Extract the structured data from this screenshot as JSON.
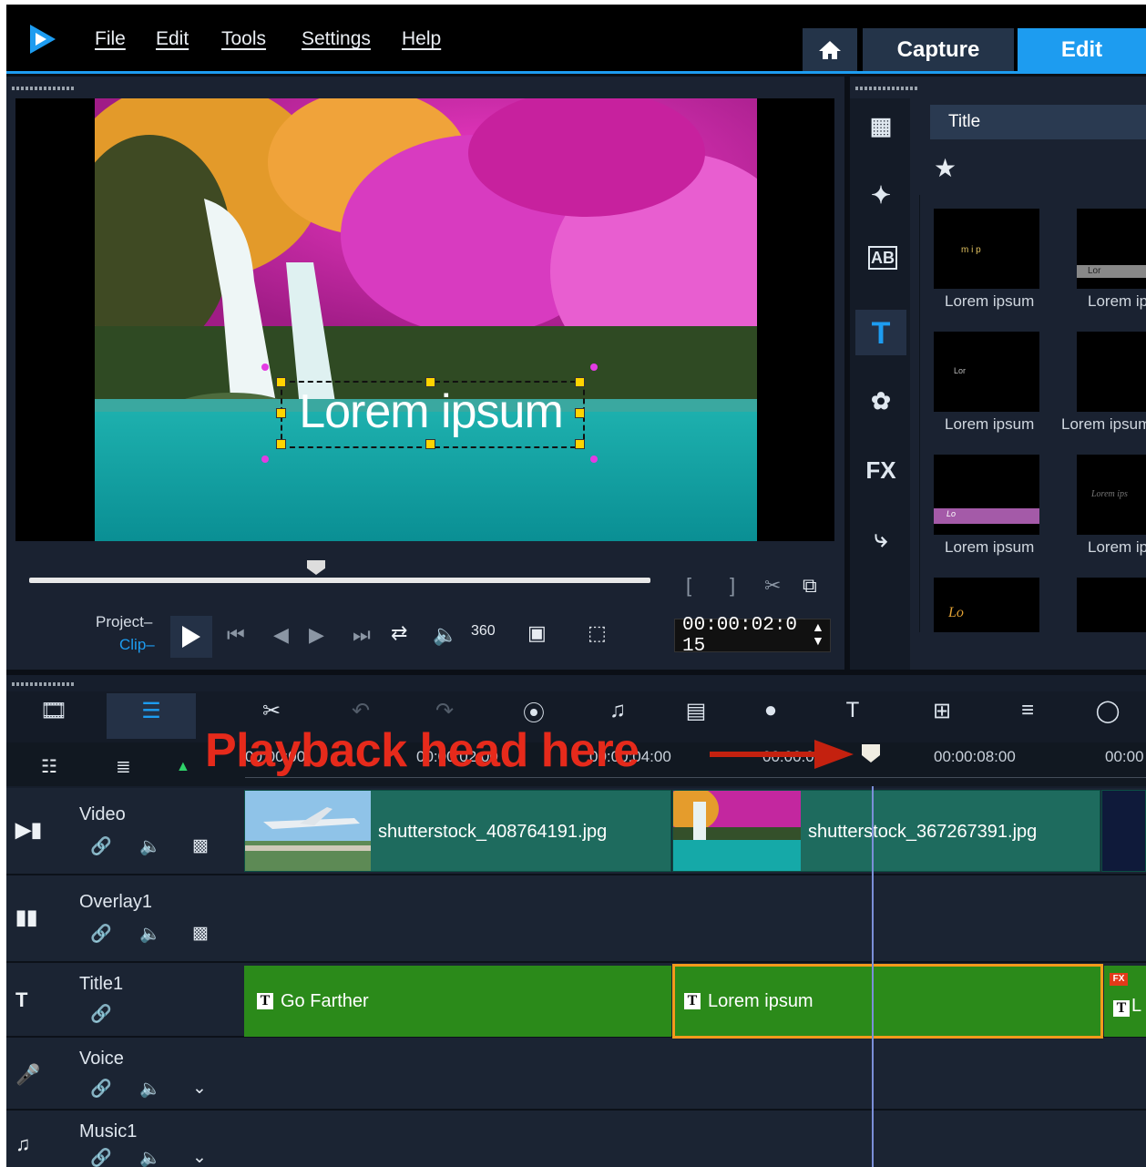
{
  "menu": {
    "file": "File",
    "edit": "Edit",
    "tools": "Tools",
    "settings": "Settings",
    "help": "Help"
  },
  "nav": {
    "capture": "Capture",
    "edit": "Edit"
  },
  "preview": {
    "overlay_text": "Lorem ipsum",
    "project_label": "Project–",
    "clip_label": "Clip–",
    "timecode": "00:00:02:0 15"
  },
  "library": {
    "category": "Title",
    "items": [
      {
        "label": "Lorem ipsum",
        "thumb_text": "m  i  p"
      },
      {
        "label": "Lorem ips",
        "thumb_text": "Lor"
      },
      {
        "label": "Lorem ipsum",
        "thumb_text": "Lor"
      },
      {
        "label": "Lorem ipsum",
        "thumb_text": ""
      },
      {
        "label": "Lorem ipsum",
        "thumb_text": "Lo"
      },
      {
        "label": "Lorem ips",
        "thumb_text": "Lorem ips"
      },
      {
        "label": "",
        "thumb_text": "Lo"
      },
      {
        "label": "",
        "thumb_text": ""
      }
    ]
  },
  "timeline": {
    "ruler": [
      "00:00:00",
      "00:00:02:00",
      "00:00:04:00",
      "00:00:0",
      "00:00:08:00",
      "00:00"
    ],
    "annotation": "Playback head here",
    "tracks": {
      "video": "Video",
      "overlay": "Overlay1",
      "title": "Title1",
      "voice": "Voice",
      "music": "Music1"
    },
    "video_clips": [
      "shutterstock_408764191.jpg",
      "shutterstock_367267391.jpg"
    ],
    "title_clips": [
      "Go Farther",
      "Lorem ipsum",
      "L"
    ]
  },
  "colors": {
    "accent": "#1d9cf0",
    "annotation": "#e62a1b",
    "title_clip": "#2b8a1a",
    "video_clip": "#1e6b5e"
  }
}
